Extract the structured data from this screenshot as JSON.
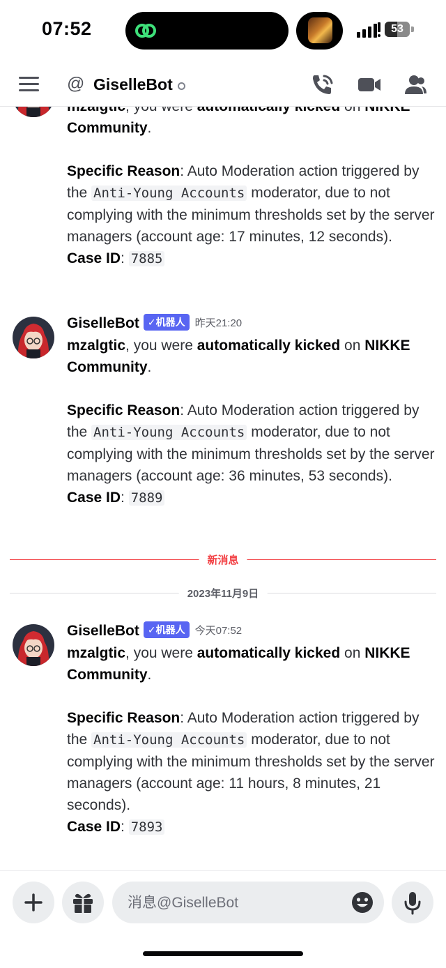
{
  "status": {
    "time": "07:52",
    "battery": "53"
  },
  "header": {
    "at_symbol": "@",
    "title": "GiselleBot"
  },
  "partial_message": {
    "line1_user": "mzalgtic",
    "line1_mid": ", you were ",
    "line1_action": "automatically kicked",
    "line1_on": " on ",
    "line1_server": "NIKKE",
    "server_cont": "Community",
    "period": ".",
    "reason_label": "Specific Reason",
    "reason_pre": ": Auto Moderation action triggered by the ",
    "moderator": "Anti-Young Accounts",
    "reason_post": " moderator, due to not complying with the minimum thresholds set by the server managers (account age: 17 minutes, 12 seconds).",
    "case_label": "Case ID",
    "case_sep": ": ",
    "case_id": "7885"
  },
  "messages": [
    {
      "author": "GiselleBot",
      "badge": "✓机器人",
      "time": "昨天21:20",
      "user": "mzalgtic",
      "mid": ", you were ",
      "action": "automatically kicked",
      "on": " on ",
      "server": "NIKKE Community",
      "period": ".",
      "reason_label": "Specific Reason",
      "reason_pre": ": Auto Moderation action triggered by the ",
      "moderator": "Anti-Young Accounts",
      "reason_post": " moderator, due to not complying with the minimum thresholds set by the server managers (account age: 36 minutes, 53 seconds).",
      "case_label": "Case ID",
      "case_sep": ": ",
      "case_id": "7889"
    },
    {
      "author": "GiselleBot",
      "badge": "✓机器人",
      "time": "今天07:52",
      "user": "mzalgtic",
      "mid": ", you were ",
      "action": "automatically kicked",
      "on": " on ",
      "server": "NIKKE Community",
      "period": ".",
      "reason_label": "Specific Reason",
      "reason_pre": ": Auto Moderation action triggered by the ",
      "moderator": "Anti-Young Accounts",
      "reason_post": " moderator, due to not complying with the minimum thresholds set by the server managers (account age: 11 hours, 8 minutes, 21 seconds).",
      "case_label": "Case ID",
      "case_sep": ": ",
      "case_id": "7893"
    }
  ],
  "dividers": {
    "new_messages": "新消息",
    "date": "2023年11月9日"
  },
  "input": {
    "placeholder": "消息@GiselleBot"
  },
  "colors": {
    "accent": "#5865f2",
    "new_divider": "#f23f43",
    "date_divider": "#dcdde0"
  },
  "icons": [
    "menu-icon",
    "at-icon",
    "status-dot-icon",
    "phone-call-icon",
    "video-camera-icon",
    "members-icon",
    "plus-icon",
    "gift-icon",
    "emoji-icon",
    "microphone-icon"
  ]
}
